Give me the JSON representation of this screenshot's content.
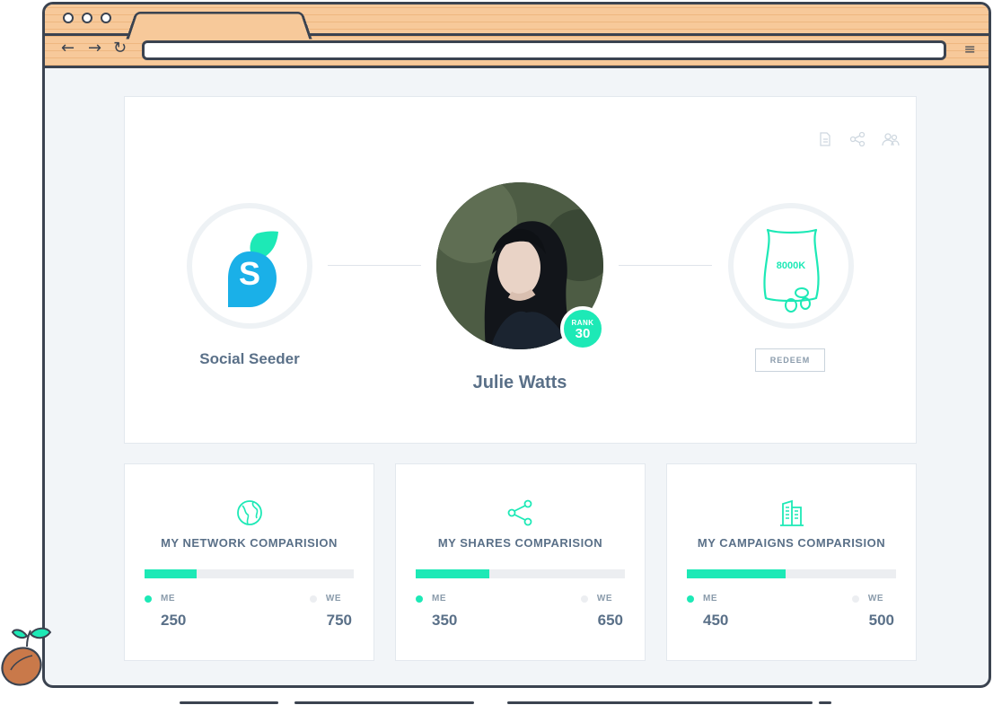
{
  "browser": {
    "nav": {
      "back": "←",
      "forward": "→",
      "reload": "↻",
      "menu": "≡"
    },
    "url": ""
  },
  "profile": {
    "brand_name": "Social Seeder",
    "brand_logo_letter": "S",
    "user_name": "Julie Watts",
    "rank_label": "RANK",
    "rank_value": "30",
    "seed_bag_label": "8000K",
    "redeem_label": "REDEEM",
    "top_icons": [
      "document-icon",
      "share-icon",
      "users-icon"
    ]
  },
  "stats": [
    {
      "title": "MY NETWORK COMPARISION",
      "icon": "globe-icon",
      "me_label": "ME",
      "we_label": "WE",
      "me": "250",
      "we": "750",
      "me_fraction": 0.25
    },
    {
      "title": "MY SHARES COMPARISION",
      "icon": "share-icon",
      "me_label": "ME",
      "we_label": "WE",
      "me": "350",
      "we": "650",
      "me_fraction": 0.35
    },
    {
      "title": "MY CAMPAIGNS COMPARISION",
      "icon": "building-icon",
      "me_label": "ME",
      "we_label": "WE",
      "me": "450",
      "we": "500",
      "me_fraction": 0.474
    }
  ],
  "colors": {
    "accent": "#1de9b6",
    "logo_blue": "#1ab0e8",
    "text": "#5a7088",
    "we_dot": "#eceef1"
  }
}
